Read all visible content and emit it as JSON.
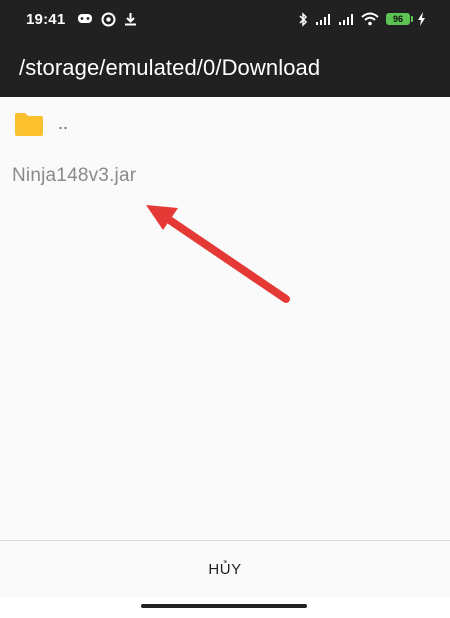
{
  "status_bar": {
    "time": "19:41",
    "left_icons": [
      "game-controller-icon",
      "sync-icon",
      "download-icon"
    ],
    "right_icons": [
      "bluetooth-icon",
      "signal-icon",
      "signal-icon",
      "wifi-icon",
      "battery-icon",
      "charging-icon"
    ],
    "battery_level": "96",
    "battery_color": "#5dc453"
  },
  "app_bar": {
    "title": "/storage/emulated/0/Download",
    "background": "#212121"
  },
  "file_list": {
    "parent_dir": {
      "label": "..",
      "icon": "folder-icon",
      "icon_color": "#fbc02d"
    },
    "files": [
      {
        "name": "Ninja148v3.jar"
      }
    ]
  },
  "annotation": {
    "type": "arrow",
    "color": "#e53935"
  },
  "dialog": {
    "cancel_label": "HỦY"
  }
}
